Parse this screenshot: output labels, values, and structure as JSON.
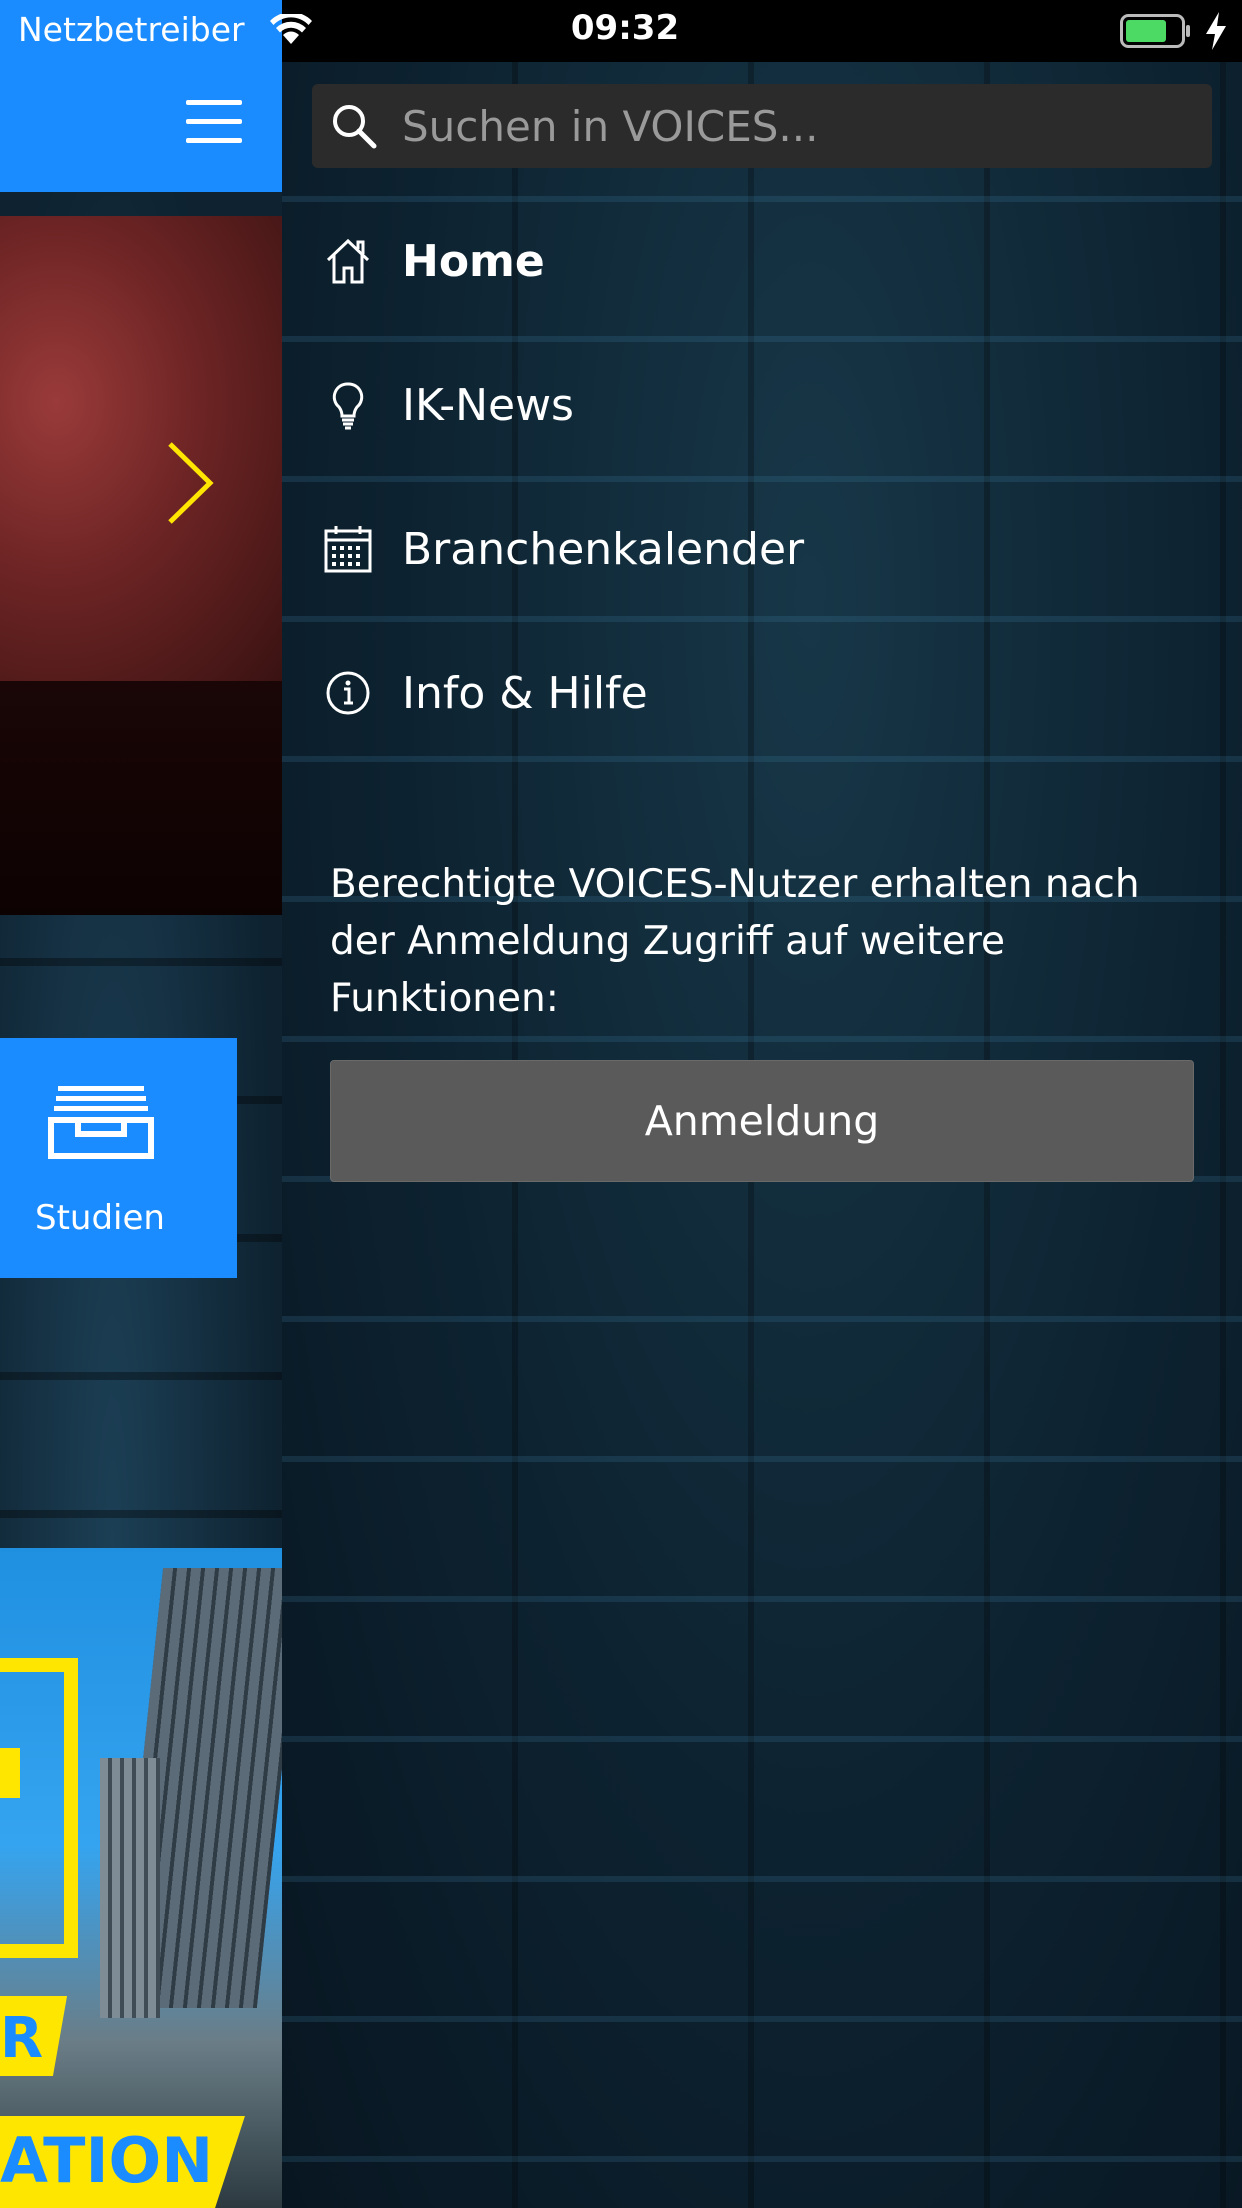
{
  "status_bar": {
    "carrier": "Netzbetreiber",
    "time": "09:32",
    "battery_color": "#4cd964"
  },
  "left_page": {
    "header_color": "#1a8cff",
    "studien_label": "Studien",
    "promo_text_line1": "R",
    "promo_text_line2": "ATION",
    "accent_yellow": "#ffe600"
  },
  "menu": {
    "search_placeholder": "Suchen in VOICES...",
    "items": [
      {
        "label": "Home",
        "icon": "home-icon",
        "active": true
      },
      {
        "label": "IK-News",
        "icon": "lightbulb-icon",
        "active": false
      },
      {
        "label": "Branchenkalender",
        "icon": "calendar-icon",
        "active": false
      },
      {
        "label": "Info & Hilfe",
        "icon": "info-icon",
        "active": false
      }
    ],
    "login_text": "Berechtigte VOICES-Nutzer erhalten nach der Anmeldung Zugriff auf weitere Funktionen:",
    "login_button": "Anmeldung"
  }
}
